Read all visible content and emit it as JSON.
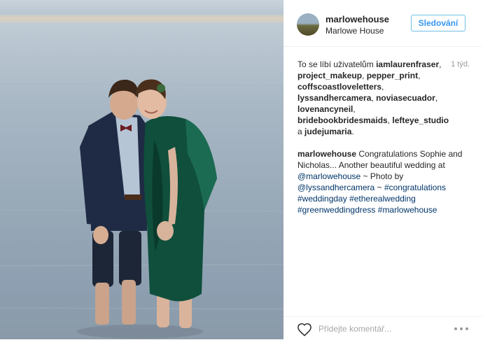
{
  "post": {
    "author": {
      "username": "marlowehouse",
      "location": "Marlowe House"
    },
    "follow_label": "Sledování",
    "likes": {
      "prefix": "To se líbí uživatelům",
      "time_ago": "1 týd.",
      "users": [
        "iamlaurenfraser",
        "project_makeup",
        "pepper_print",
        "coffscoastloveletters",
        "lyssandhercamera",
        "noviasecuador",
        "lovenancyneil",
        "bridebookbridesmaids",
        "lefteye_studio",
        "judejumaria"
      ],
      "conjunction": "a"
    },
    "caption": {
      "username": "marlowehouse",
      "text_1": "Congratulations Sophie and Nicholas... Another beautiful wedding at",
      "mention_1": "@marlowehouse",
      "text_2": "~ Photo by",
      "mention_2": "@lyssandhercamera",
      "text_3": "~",
      "hashtags": [
        "#congratulations",
        "#weddingday",
        "#etherealwedding",
        "#greenweddingdress",
        "#marlowehouse"
      ]
    },
    "comment_placeholder": "Přidejte komentář...",
    "icons": {
      "like": "heart-outline-icon",
      "more": "more-options-icon"
    },
    "colors": {
      "link": "#003569",
      "follow": "#3897f0",
      "text": "#262626",
      "muted": "#999999"
    }
  }
}
